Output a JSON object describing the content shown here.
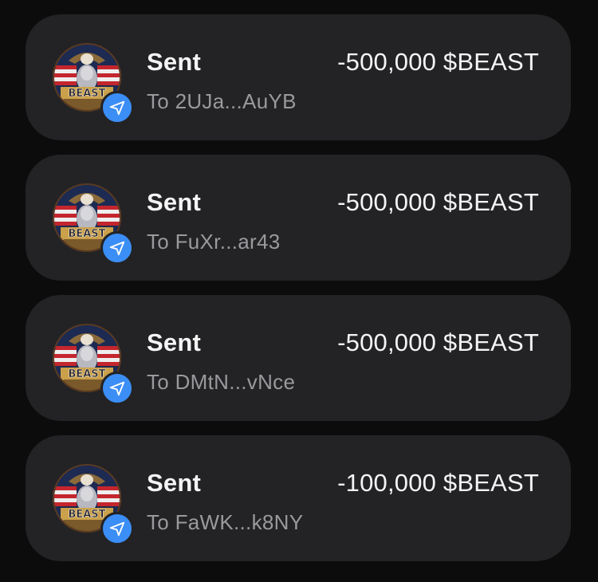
{
  "transactions": [
    {
      "title": "Sent",
      "recipient": "To 2UJa...AuYB",
      "amount": "-500,000 $BEAST",
      "avatar_text": "BEAST",
      "avatar_icon": "beast-token-logo",
      "badge_icon": "send-arrow-icon"
    },
    {
      "title": "Sent",
      "recipient": "To FuXr...ar43",
      "amount": "-500,000 $BEAST",
      "avatar_text": "BEAST",
      "avatar_icon": "beast-token-logo",
      "badge_icon": "send-arrow-icon"
    },
    {
      "title": "Sent",
      "recipient": "To DMtN...vNce",
      "amount": "-500,000 $BEAST",
      "avatar_text": "BEAST",
      "avatar_icon": "beast-token-logo",
      "badge_icon": "send-arrow-icon"
    },
    {
      "title": "Sent",
      "recipient": "To FaWK...k8NY",
      "amount": "-100,000 $BEAST",
      "avatar_text": "BEAST",
      "avatar_icon": "beast-token-logo",
      "badge_icon": "send-arrow-icon"
    }
  ],
  "colors": {
    "background": "#0c0c0d",
    "card": "#232325",
    "badge": "#3b8ef5",
    "primary_text": "#f4f4f5",
    "secondary_text": "#9a9a9e"
  }
}
